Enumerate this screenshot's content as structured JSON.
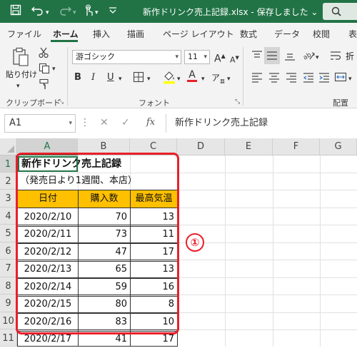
{
  "titlebar": {
    "title": "新作ドリンク売上記録.xlsx - 保存しました",
    "title_chevron": "⌄",
    "save_icon": "save-icon",
    "undo_icon": "undo-icon",
    "redo_icon": "redo-icon",
    "touch_icon": "touch-mode-icon",
    "customize_icon": "customize-toolbar-icon"
  },
  "tabs": [
    "ファイル",
    "ホーム",
    "挿入",
    "描画",
    "ページ レイアウト",
    "数式",
    "データ",
    "校閲",
    "表"
  ],
  "ribbon": {
    "clipboard": {
      "paste_label": "貼り付け",
      "group_label": "クリップボード"
    },
    "font": {
      "font_name": "游ゴシック",
      "font_size": "11",
      "bold": "B",
      "italic": "I",
      "underline": "U",
      "grow": "A",
      "shrink": "A",
      "group_label": "フォント"
    },
    "alignment": {
      "group_label": "配置",
      "wrap_label": "折"
    }
  },
  "formula_bar": {
    "name_box": "A1",
    "cancel": "✕",
    "enter": "✓",
    "fx": "fx",
    "formula": "新作ドリンク売上記録"
  },
  "grid": {
    "columns": [
      "A",
      "B",
      "C",
      "D",
      "E",
      "F",
      "G"
    ],
    "rows": [
      "1",
      "2",
      "3",
      "4",
      "5",
      "6",
      "7",
      "8",
      "9",
      "10",
      "11"
    ],
    "title": "新作ドリンク売上記録",
    "subtitle": "（発売日より1週間、本店）",
    "headers": [
      "日付",
      "購入数",
      "最高気温"
    ],
    "data": [
      [
        "2020/2/10",
        "70",
        "13"
      ],
      [
        "2020/2/11",
        "73",
        "11"
      ],
      [
        "2020/2/12",
        "47",
        "17"
      ],
      [
        "2020/2/13",
        "65",
        "13"
      ],
      [
        "2020/2/14",
        "59",
        "16"
      ],
      [
        "2020/2/15",
        "80",
        "8"
      ],
      [
        "2020/2/16",
        "83",
        "10"
      ],
      [
        "2020/2/17",
        "41",
        "17"
      ]
    ],
    "header_fill": "#ffc000"
  },
  "annotation": {
    "marker": "①",
    "color": "#e8202a"
  },
  "colors": {
    "accent": "#217346"
  }
}
